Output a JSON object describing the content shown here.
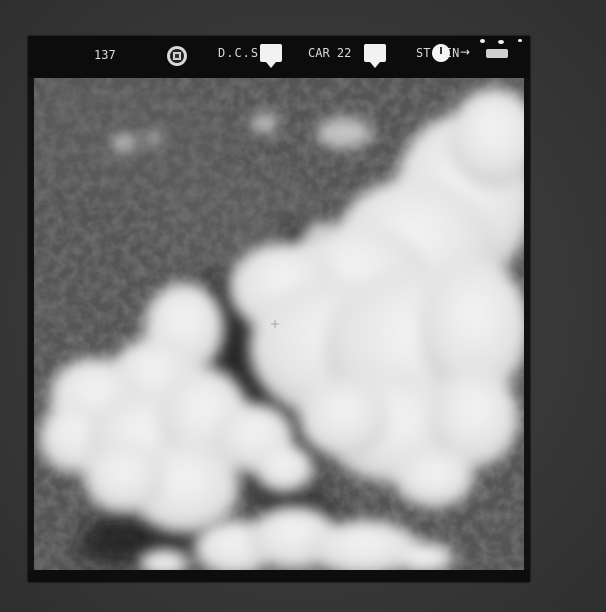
{
  "photo": {
    "frame_number": "137",
    "mission_code": "D.C.S.",
    "car_label": "CAR 22",
    "location_code": "ST VIN"
  },
  "colors": {
    "mount": "#3a3a3a",
    "border": "#111111",
    "canopy": "#2f2f2f",
    "cloud": "#e8e8e8"
  },
  "icons": [
    "insignia-seal-icon",
    "flag-tag-icon",
    "clock-dial-icon",
    "arrow-right-icon",
    "counter-icon"
  ]
}
